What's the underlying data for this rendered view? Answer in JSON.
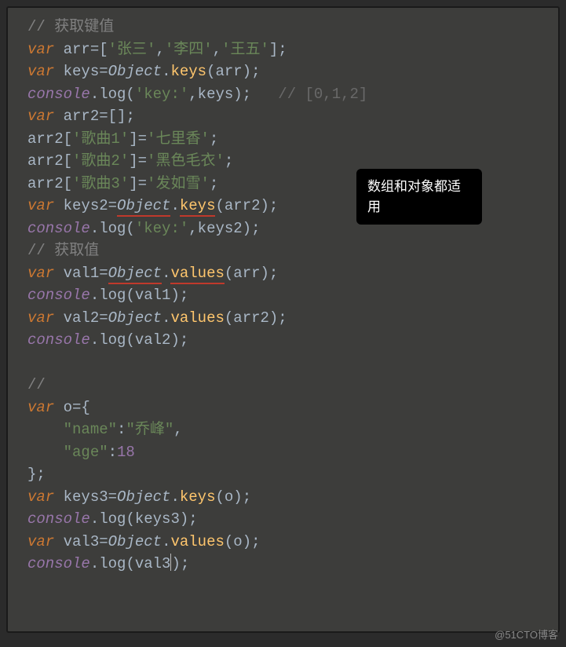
{
  "annotation": "数组和对象都适用",
  "watermark": "@51CTO博客",
  "code": {
    "c1": "// 获取键值",
    "l2_var": "var",
    "l2_arr": " arr",
    "l2_eq": "=[",
    "l2_s1": "'张三'",
    "l2_c": ",",
    "l2_s2": "'李四'",
    "l2_s3": "'王五'",
    "l2_end": "];",
    "l3_var": "var",
    "l3_keys": " keys",
    "l3_eq": "=",
    "l3_obj": "Object",
    "l3_dot": ".",
    "l3_m": "keys",
    "l3_p": "(arr);",
    "l4_cons": "console",
    "l4_log": ".log(",
    "l4_s": "'key:'",
    "l4_rest": ",keys);   ",
    "l4_cmt": "// [0,1,2]",
    "l5_var": "var",
    "l5_arr2": " arr2",
    "l5_end": "=[];",
    "l6_a": "arr2[",
    "l6_s": "'歌曲1'",
    "l6_eq": "]=",
    "l6_v": "'七里香'",
    "l6_end": ";",
    "l7_a": "arr2[",
    "l7_s": "'歌曲2'",
    "l7_v": "'黑色毛衣'",
    "l8_a": "arr2[",
    "l8_s": "'歌曲3'",
    "l8_v": "'发如雪'",
    "l9_var": "var",
    "l9_keys2": " keys2",
    "l9_obj": "Object",
    "l9_m": "keys",
    "l9_p": "(arr2);",
    "l10_s": "'key:'",
    "l10_rest": ",keys2);",
    "c2": "// 获取值",
    "l12_var": "var",
    "l12_val1": " val1",
    "l12_obj": "Object",
    "l12_m": "values",
    "l12_p": "(arr);",
    "l13_rest": "(val1);",
    "l14_var": "var",
    "l14_val2": " val2",
    "l14_obj": "Object",
    "l14_m": "values",
    "l14_p": "(arr2);",
    "l15_rest": "(val2);",
    "c3": "//",
    "l17_var": "var",
    "l17_o": " o",
    "l17_eq": "={",
    "l18_pad": "    ",
    "l18_k": "\"name\"",
    "l18_c": ":",
    "l18_v": "\"乔峰\"",
    "l18_end": ",",
    "l19_k": "\"age\"",
    "l19_v": "18",
    "l20": "};",
    "l21_var": "var",
    "l21_keys3": " keys3",
    "l21_obj": "Object",
    "l21_m": "keys",
    "l21_p": "(o);",
    "l22_rest": "(keys3);",
    "l23_var": "var",
    "l23_val3": " val3",
    "l23_obj": "Object",
    "l23_m": "values",
    "l23_p": "(o);",
    "l24_a": "(val3",
    "l24_b": ");"
  }
}
